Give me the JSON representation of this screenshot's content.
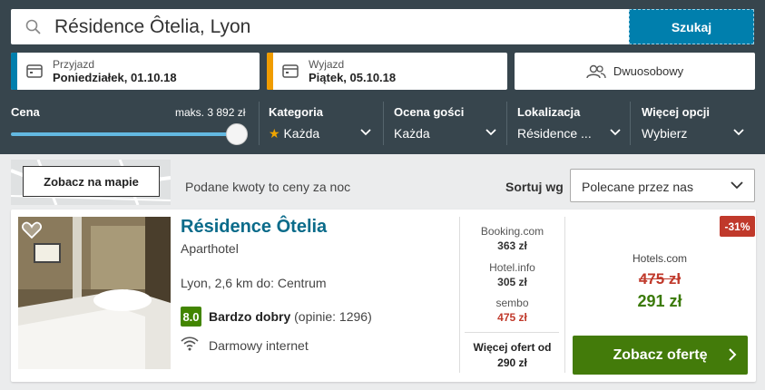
{
  "search": {
    "value": "Résidence Ôtelia, Lyon",
    "button": "Szukaj"
  },
  "dates": {
    "checkin": {
      "label": "Przyjazd",
      "value": "Poniedziałek, 01.10.18",
      "color": "#007fad"
    },
    "checkout": {
      "label": "Wyjazd",
      "value": "Piątek, 05.10.18",
      "color": "#f09c00"
    }
  },
  "room": {
    "label": "Dwuosobowy"
  },
  "filters": {
    "price": {
      "label": "Cena",
      "max": "maks. 3 892 zł",
      "level": 1.0
    },
    "category": {
      "label": "Kategoria",
      "value": "Każda"
    },
    "rating": {
      "label": "Ocena gości",
      "value": "Każda"
    },
    "location": {
      "label": "Lokalizacja",
      "value": "Résidence ..."
    },
    "more": {
      "label": "Więcej opcji",
      "value": "Wybierz"
    }
  },
  "toolbar": {
    "map_button": "Zobacz na mapie",
    "notice": "Podane kwoty to ceny za noc",
    "sort_label": "Sortuj wg",
    "sort_value": "Polecane przez nas"
  },
  "hotel": {
    "name": "Résidence Ôtelia",
    "type": "Aparthotel",
    "location": "Lyon, 2,6 km do: Centrum",
    "score": "8.0",
    "rating_label": "Bardzo dobry",
    "rating_count": "(opinie: 1296)",
    "amenity": "Darmowy internet",
    "offers": [
      {
        "site": "Booking.com",
        "price": "363 zł"
      },
      {
        "site": "Hotel.info",
        "price": "305 zł"
      },
      {
        "site": "sembo",
        "price": "475 zł"
      }
    ],
    "more_offers_label": "Więcej ofert od",
    "more_offers_price": "290 zł",
    "discount": "-31%",
    "best_site": "Hotels.com",
    "old_price": "475 zł",
    "new_price": "291 zł",
    "cta": "Zobacz ofertę"
  }
}
